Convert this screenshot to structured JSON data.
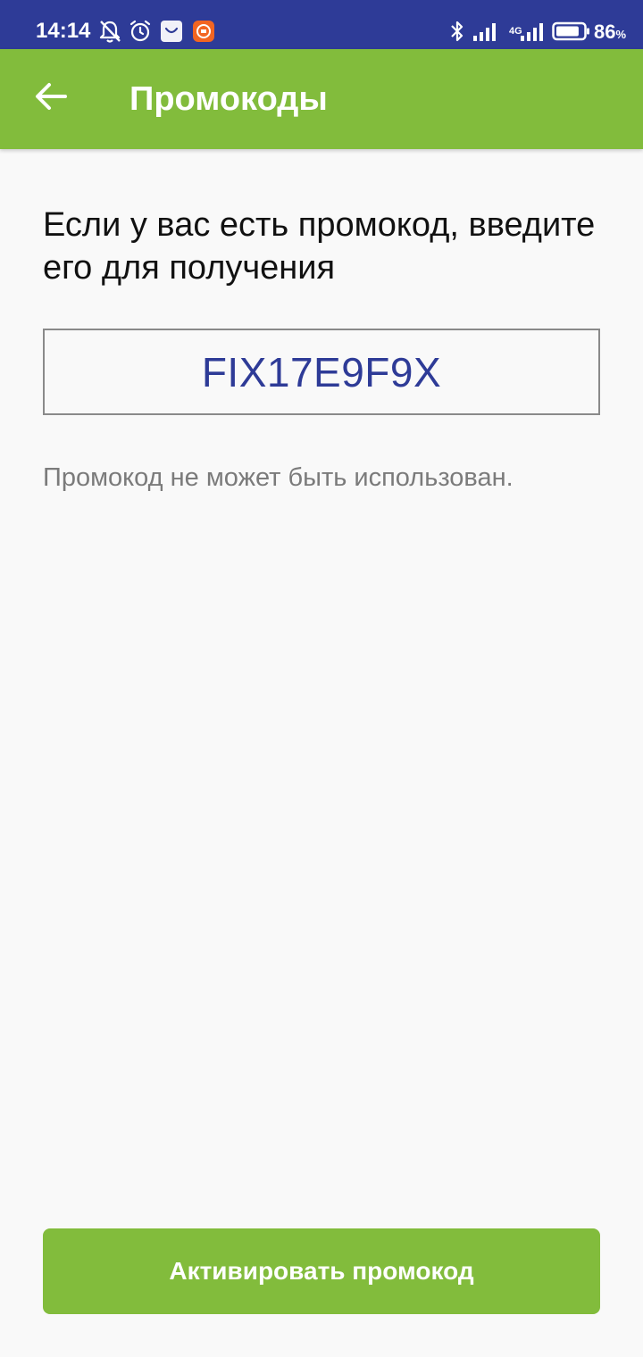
{
  "status_bar": {
    "time": "14:14",
    "network": "4G",
    "battery_percent": "86",
    "battery_unit": "%",
    "battery_level": 0.86,
    "icons": [
      "bell-off-icon",
      "alarm-icon",
      "shop-app-icon",
      "mi-app-icon",
      "bluetooth-icon",
      "signal-icon",
      "signal-4g-icon",
      "battery-icon"
    ]
  },
  "app_bar": {
    "title": "Промокоды",
    "back_icon": "arrow-back-icon"
  },
  "main": {
    "instruction": "Если у вас есть промокод, введите его для получения",
    "promo_value": "FIX17E9F9X",
    "error_message": "Промокод не может быть использован."
  },
  "actions": {
    "activate_label": "Активировать промокод"
  },
  "colors": {
    "status_bar": "#2e3b97",
    "accent": "#82bc3c",
    "promo_text": "#2e3b97",
    "background": "#f9f9f9",
    "error_text": "#7b7b7b"
  }
}
